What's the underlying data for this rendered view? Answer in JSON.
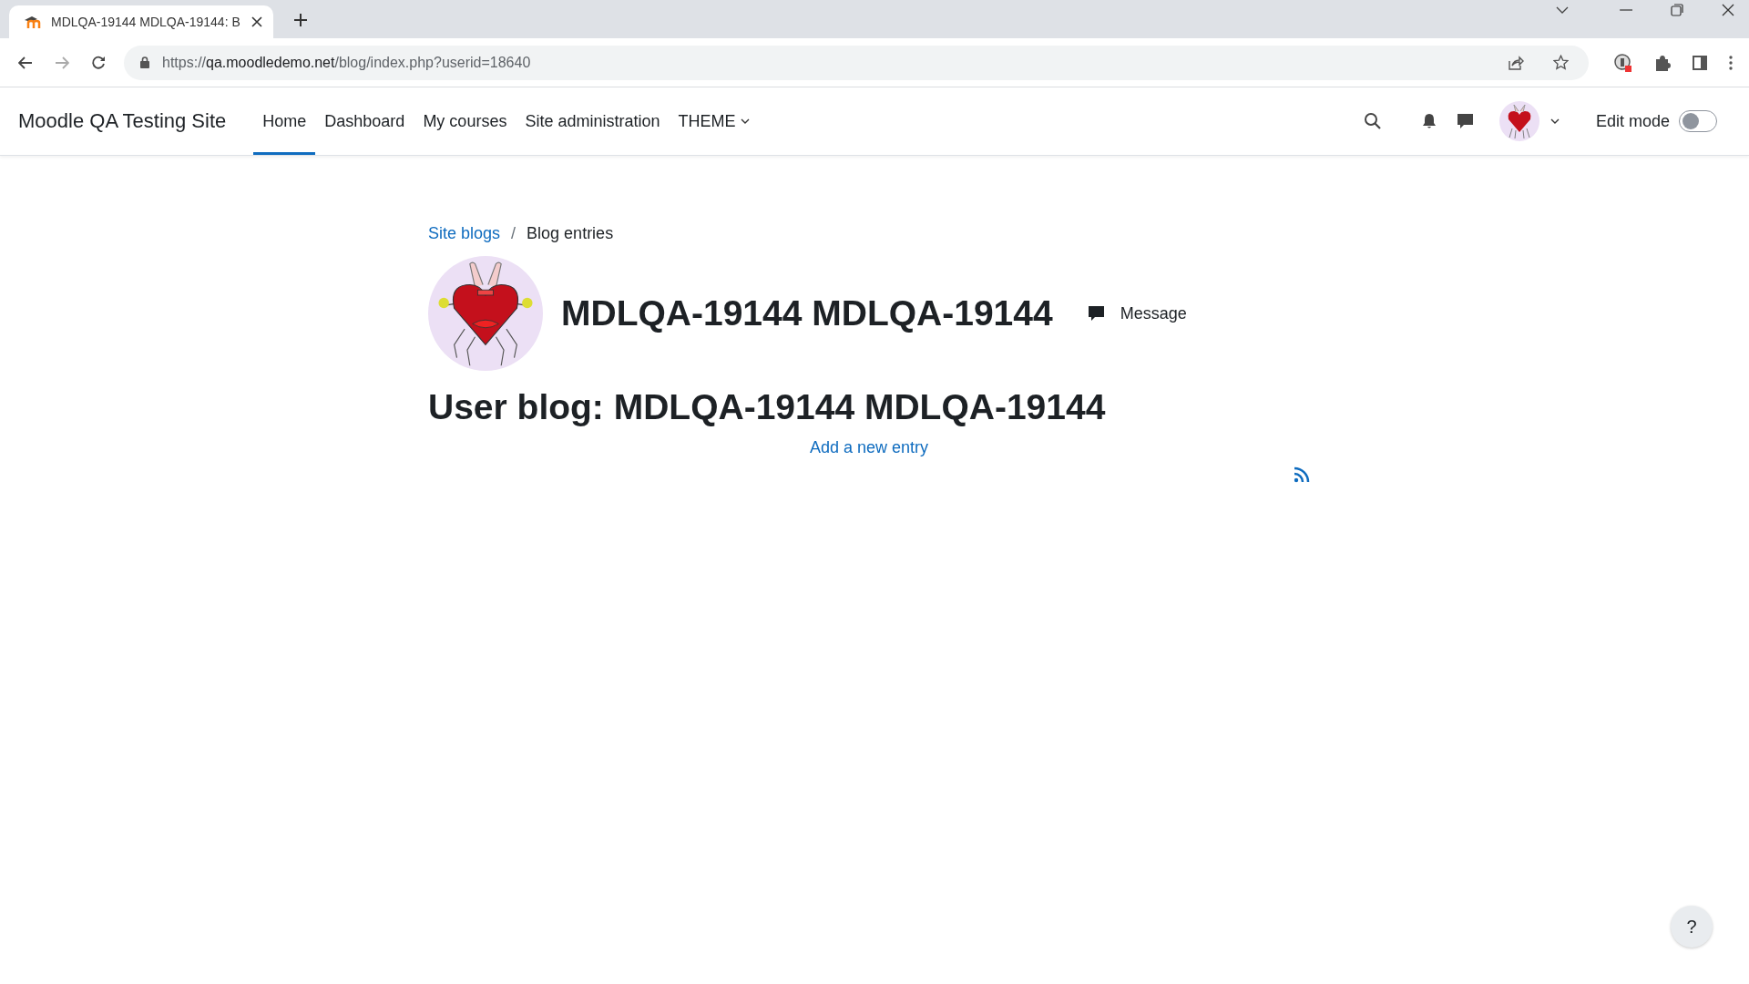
{
  "browser": {
    "tab": {
      "title": "MDLQA-19144 MDLQA-19144: B"
    },
    "url": {
      "host": "qa.moodledemo.net",
      "prefix": "https://",
      "path": "/blog/index.php?userid=18640"
    }
  },
  "navbar": {
    "site_name": "Moodle QA Testing Site",
    "items": [
      {
        "label": "Home",
        "selected": true,
        "kind": "link"
      },
      {
        "label": "Dashboard",
        "selected": false,
        "kind": "link"
      },
      {
        "label": "My courses",
        "selected": false,
        "kind": "link"
      },
      {
        "label": "Site administration",
        "selected": false,
        "kind": "link"
      },
      {
        "label": "THEME",
        "selected": false,
        "kind": "dropdown"
      }
    ],
    "edit_mode": {
      "label": "Edit mode",
      "on": false
    }
  },
  "breadcrumb_separator": "/",
  "breadcrumb": [
    {
      "label": "Site blogs",
      "kind": "link"
    },
    {
      "label": "Blog entries",
      "kind": "current"
    }
  ],
  "profile": {
    "name": "MDLQA-19144 MDLQA-19144",
    "message_label": "Message"
  },
  "heading": "User blog: MDLQA-19144 MDLQA-19144",
  "add_entry_link": "Add a new entry",
  "help_button": "?"
}
